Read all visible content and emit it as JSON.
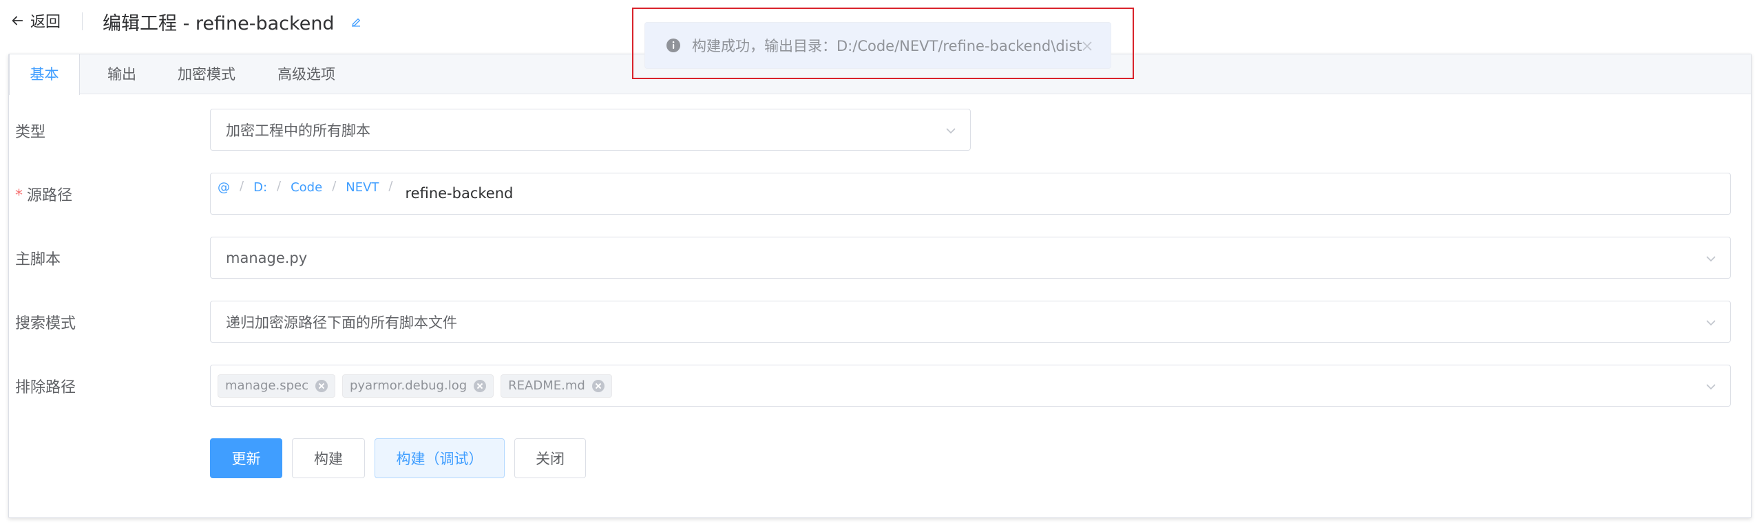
{
  "header": {
    "back_label": "返回",
    "title": "编辑工程 - refine-backend"
  },
  "tabs": [
    {
      "label": "基本"
    },
    {
      "label": "输出"
    },
    {
      "label": "加密模式"
    },
    {
      "label": "高级选项"
    }
  ],
  "form": {
    "type": {
      "label": "类型",
      "value": "加密工程中的所有脚本"
    },
    "source_path": {
      "label": "源路径",
      "required_mark": "*",
      "crumbs": [
        "@",
        "D:",
        "Code",
        "NEVT"
      ],
      "separator": "/",
      "input_value": "refine-backend"
    },
    "main_script": {
      "label": "主脚本",
      "value": "manage.py"
    },
    "search_mode": {
      "label": "搜索模式",
      "value": "递归加密源路径下面的所有脚本文件"
    },
    "exclude_paths": {
      "label": "排除路径",
      "tags": [
        "manage.spec",
        "pyarmor.debug.log",
        "README.md"
      ]
    }
  },
  "buttons": {
    "update": "更新",
    "build": "构建",
    "build_debug": "构建（调试）",
    "close": "关闭"
  },
  "message": {
    "text": "构建成功，输出目录：D:/Code/NEVT/refine-backend\\dist"
  },
  "colors": {
    "accent": "#409eff",
    "required": "#f56c6c",
    "highlight_box": "#d9232b"
  }
}
